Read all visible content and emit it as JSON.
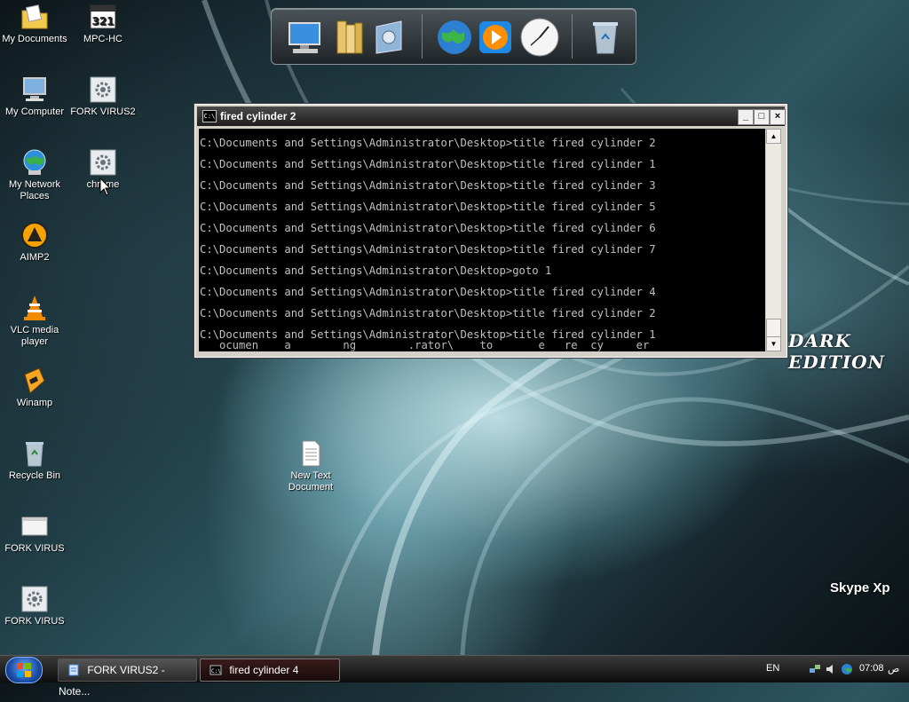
{
  "desktop_icons": [
    {
      "label": "My Documents",
      "icon": "folder-documents-icon"
    },
    {
      "label": "MPC-HC",
      "icon": "media-player-classic-icon"
    },
    {
      "label": "My Computer",
      "icon": "computer-icon"
    },
    {
      "label": "FORK VIRUS2",
      "icon": "batch-file-icon"
    },
    {
      "label": "My Network Places",
      "icon": "network-globe-icon"
    },
    {
      "label": "chrome",
      "icon": "batch-file-icon"
    },
    {
      "label": "AIMP2",
      "icon": "aimp-icon"
    },
    {
      "label": "VLC media player",
      "icon": "vlc-cone-icon"
    },
    {
      "label": "Winamp",
      "icon": "winamp-icon"
    },
    {
      "label": "Recycle Bin",
      "icon": "recycle-bin-icon"
    },
    {
      "label": "FORK VIRUS",
      "icon": "window-file-icon"
    },
    {
      "label": "FORK VIRUS",
      "icon": "batch-file-icon"
    },
    {
      "label": "New Text Document",
      "icon": "text-document-icon"
    }
  ],
  "dock": {
    "items": [
      "computer-icon",
      "folder-icon",
      "control-panel-icon",
      "globe-icon",
      "media-play-icon",
      "clock-icon",
      "trash-icon"
    ]
  },
  "cmd_window": {
    "title": "fired cylinder 2",
    "icon_text": "C:\\",
    "lines": [
      "C:\\Documents and Settings\\Administrator\\Desktop>title fired cylinder 2",
      "C:\\Documents and Settings\\Administrator\\Desktop>title fired cylinder 1",
      "C:\\Documents and Settings\\Administrator\\Desktop>title fired cylinder 3",
      "C:\\Documents and Settings\\Administrator\\Desktop>title fired cylinder 5",
      "C:\\Documents and Settings\\Administrator\\Desktop>title fired cylinder 6",
      "C:\\Documents and Settings\\Administrator\\Desktop>title fired cylinder 7",
      "C:\\Documents and Settings\\Administrator\\Desktop>goto 1",
      "C:\\Documents and Settings\\Administrator\\Desktop>title fired cylinder 4",
      "C:\\Documents and Settings\\Administrator\\Desktop>title fired cylinder 2",
      "C:\\Documents and Settings\\Administrator\\Desktop>title fired cylinder 1"
    ],
    "partial_line": "   ocumen    a        ng        .rator\\    to       e   re  cy     er",
    "minimize": "_",
    "maximize": "□",
    "close": "×"
  },
  "wallpaper": {
    "edition_text": "DARK EDITION",
    "brand_text": "Skype Xp"
  },
  "taskbar": {
    "tasks": [
      {
        "label": "FORK VIRUS2 - Note...",
        "icon": "notepad-icon"
      },
      {
        "label": "fired cylinder 4",
        "icon": "cmd-icon"
      }
    ],
    "language": "EN",
    "time": "07:08",
    "ampm": "ص"
  }
}
